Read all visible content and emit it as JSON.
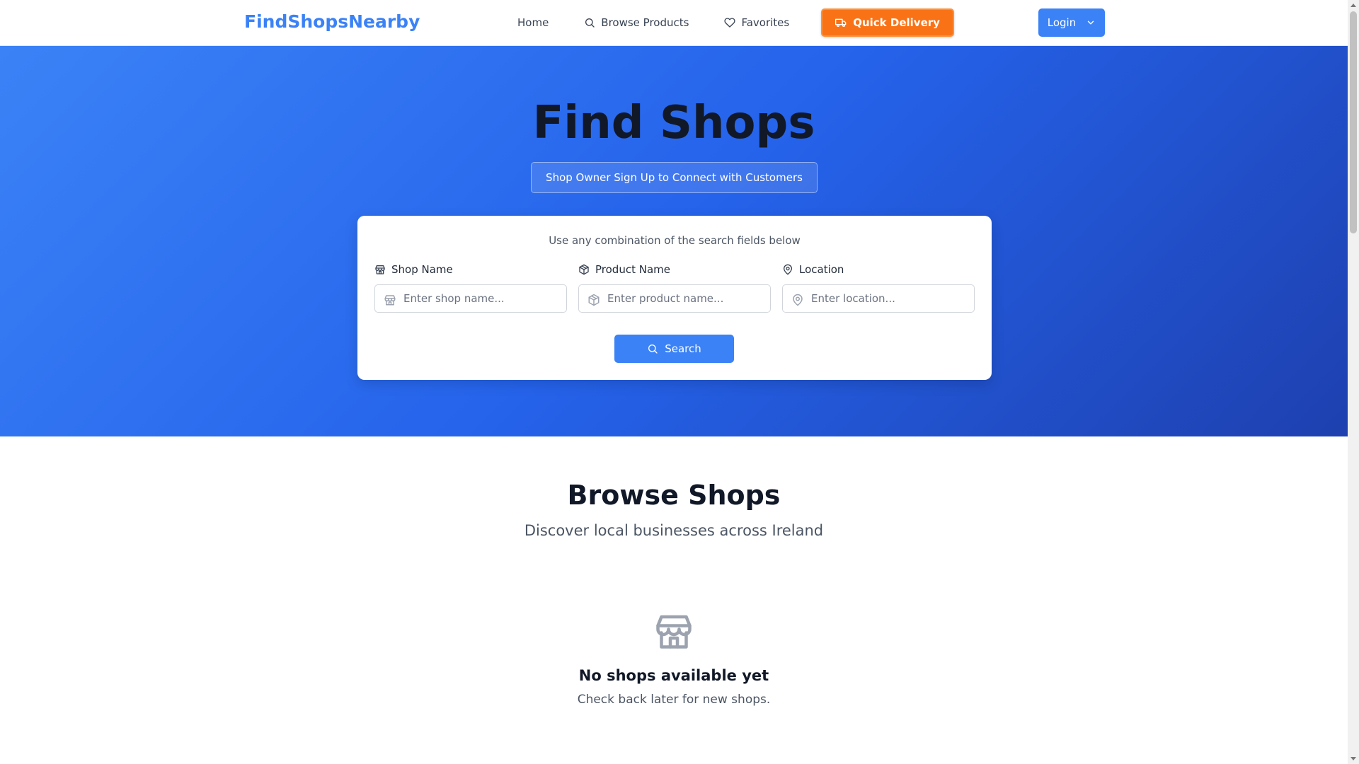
{
  "navbar": {
    "brand": "FindShopsNearby",
    "links": [
      {
        "label": "Home",
        "icon": "none"
      },
      {
        "label": "Browse Products",
        "icon": "search-icon"
      },
      {
        "label": "Favorites",
        "icon": "heart-icon"
      }
    ],
    "quick_delivery_label": "Quick Delivery",
    "login_label": "Login"
  },
  "hero": {
    "title": "Find Shops",
    "signup_label": "Shop Owner Sign Up to Connect with Customers"
  },
  "search": {
    "hint": "Use any combination of the search fields below",
    "fields": [
      {
        "label": "Shop Name",
        "placeholder": "Enter shop name...",
        "value": ""
      },
      {
        "label": "Product Name",
        "placeholder": "Enter product name...",
        "value": ""
      },
      {
        "label": "Location",
        "placeholder": "Enter location...",
        "value": ""
      }
    ],
    "button_label": "Search"
  },
  "browse": {
    "title": "Browse Shops",
    "subtitle": "Discover local businesses across Ireland",
    "empty_title": "No shops available yet",
    "empty_subtitle": "Check back later for new shops."
  },
  "colors": {
    "brand": "#3b82f6",
    "delivery": "#f97316",
    "hero_start": "#3b82f6",
    "hero_end": "#1e40af"
  }
}
